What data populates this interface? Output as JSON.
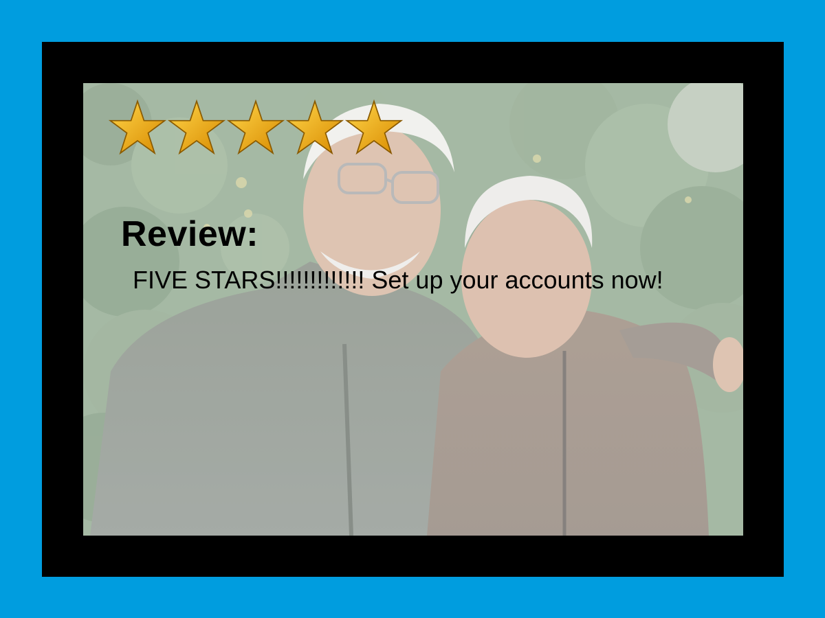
{
  "colors": {
    "border_outer": "#009ddf",
    "border_inner": "#000000",
    "star_fill": "#f5a800",
    "text": "#000000"
  },
  "rating": {
    "stars_filled": 5,
    "stars_total": 5,
    "icon": "star-icon"
  },
  "review": {
    "heading": "Review:",
    "text": "FIVE STARS!!!!!!!!!!!!! Set up your accounts now!"
  },
  "photo": {
    "icon": "elderly-couple-photo"
  }
}
